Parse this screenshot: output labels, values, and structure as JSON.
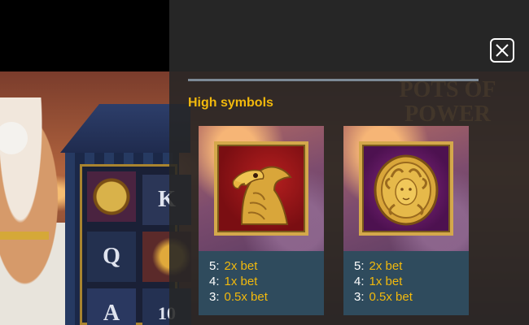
{
  "paytable": {
    "section_title": "High symbols",
    "close_button": "close-icon",
    "symbols": [
      {
        "name": "eagle",
        "icon": "eagle-icon",
        "payouts": [
          {
            "count": "5:",
            "value": "2x bet"
          },
          {
            "count": "4:",
            "value": "1x bet"
          },
          {
            "count": "3:",
            "value": "0.5x bet"
          }
        ]
      },
      {
        "name": "medusa-coin",
        "icon": "medusa-coin-icon",
        "payouts": [
          {
            "count": "5:",
            "value": "2x bet"
          },
          {
            "count": "4:",
            "value": "1x bet"
          },
          {
            "count": "3:",
            "value": "0.5x bet"
          }
        ]
      }
    ]
  },
  "background": {
    "logo_text": "POTS OF POWER",
    "reel_symbols": [
      "K",
      "Q",
      "A",
      "10"
    ]
  },
  "colors": {
    "accent_gold": "#f2b90c",
    "panel_bg": "#262626",
    "payout_bg": "#304e62",
    "divider": "#7d8a96"
  }
}
